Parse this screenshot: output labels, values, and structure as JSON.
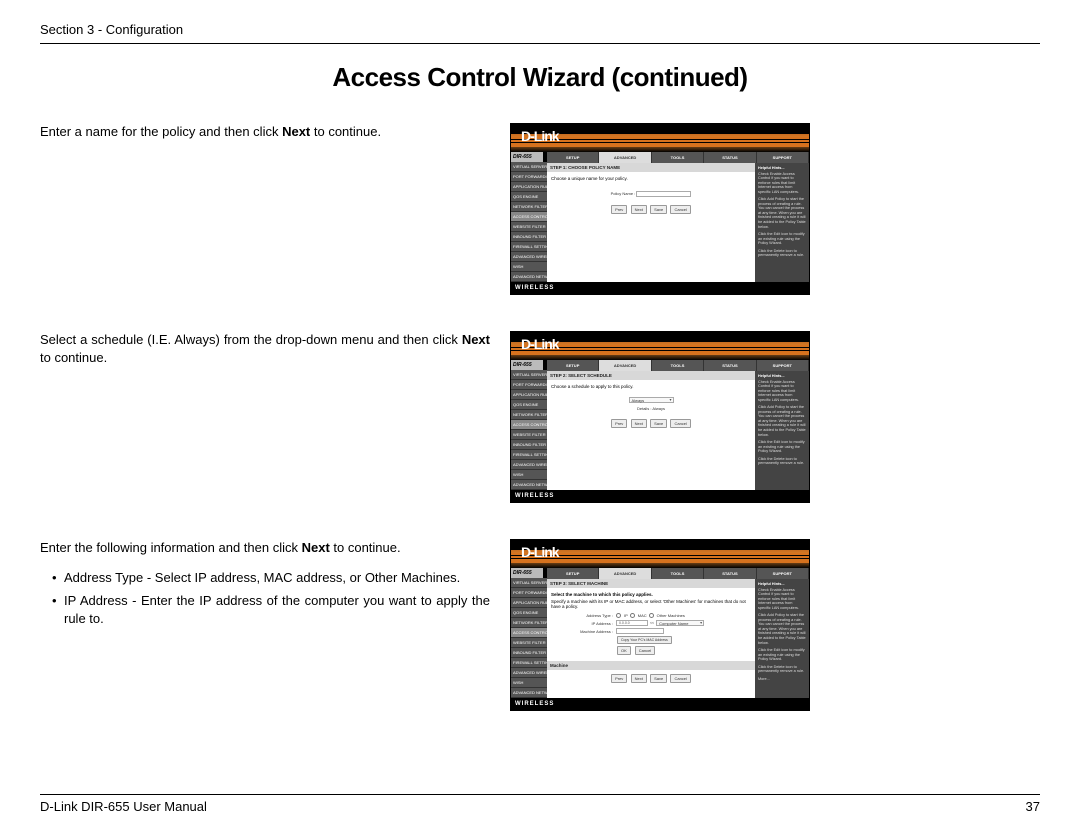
{
  "page": {
    "section_label": "Section 3 - Configuration",
    "title": "Access Control Wizard (continued)",
    "footer_left": "D-Link DIR-655 User Manual",
    "footer_right": "37"
  },
  "common": {
    "brand": "D-Link",
    "footer": "WIRELESS",
    "model": "DIR-655",
    "tabs": [
      "SETUP",
      "ADVANCED",
      "TOOLS",
      "STATUS",
      "SUPPORT"
    ],
    "sidebar_items": [
      "VIRTUAL SERVER",
      "PORT FORWARDING",
      "APPLICATION RULES",
      "QOS ENGINE",
      "NETWORK FILTER",
      "ACCESS CONTROL",
      "WEBSITE FILTER",
      "INBOUND FILTER",
      "FIREWALL SETTINGS",
      "ADVANCED WIRELESS",
      "WISH",
      "ADVANCED NETWORK"
    ],
    "buttons": {
      "prev": "Prev",
      "next": "Next",
      "save": "Save",
      "cancel": "Cancel",
      "ok": "OK"
    },
    "hints": {
      "title": "Helpful Hints...",
      "h1": "Check Enable Access Control if you want to enforce rules that limit Internet access from specific LAN computers.",
      "h2": "Click Add Policy to start the process of creating a rule. You can cancel the process at any time. When you are finished creating a rule it will be added to the Policy Table below.",
      "h3": "Click the Edit icon to modify an existing rule using the Policy Wizard.",
      "h4": "Click the Delete icon to permanently remove a rule.",
      "more": "More..."
    }
  },
  "step1": {
    "desc_pre": "Enter a name for the policy and then click ",
    "desc_bold": "Next",
    "desc_post": " to continue.",
    "panel_title": "STEP 1: CHOOSE POLICY NAME",
    "intro": "Choose a unique name for your policy.",
    "field_label": "Policy Name :"
  },
  "step2": {
    "desc_pre": "Select a schedule (I.E. Always) from the drop-down menu and then click ",
    "desc_bold": "Next",
    "desc_post": " to continue.",
    "panel_title": "STEP 2: SELECT SCHEDULE",
    "intro": "Choose a schedule to apply to this policy.",
    "select_value": "Always",
    "details_label": "Details :",
    "details_value": "Always"
  },
  "step3": {
    "desc_pre": "Enter the following information and then click ",
    "desc_bold": "Next",
    "desc_post": " to continue.",
    "bullets": [
      "Address Type - Select IP address, MAC address, or Other Machines.",
      "IP Address - Enter the IP address of the computer you want to apply the rule to."
    ],
    "panel_title": "STEP 3: SELECT MACHINE",
    "intro1": "Select the machine to which this policy applies.",
    "intro2": "Specify a machine with its IP or MAC address, or select 'Other Machines' for machines that do not have a policy.",
    "labels": {
      "address_type": "Address Type :",
      "ip_address": "IP Address :",
      "machine_address": "Machine Address :"
    },
    "radios": {
      "ip": "IP",
      "mac": "MAC",
      "other": "Other Machines"
    },
    "ip_value": "0.0.0.0",
    "computer_select": "Computer Name",
    "copy_btn": "Copy Your PC's MAC Address",
    "sub_section": "Machine"
  }
}
